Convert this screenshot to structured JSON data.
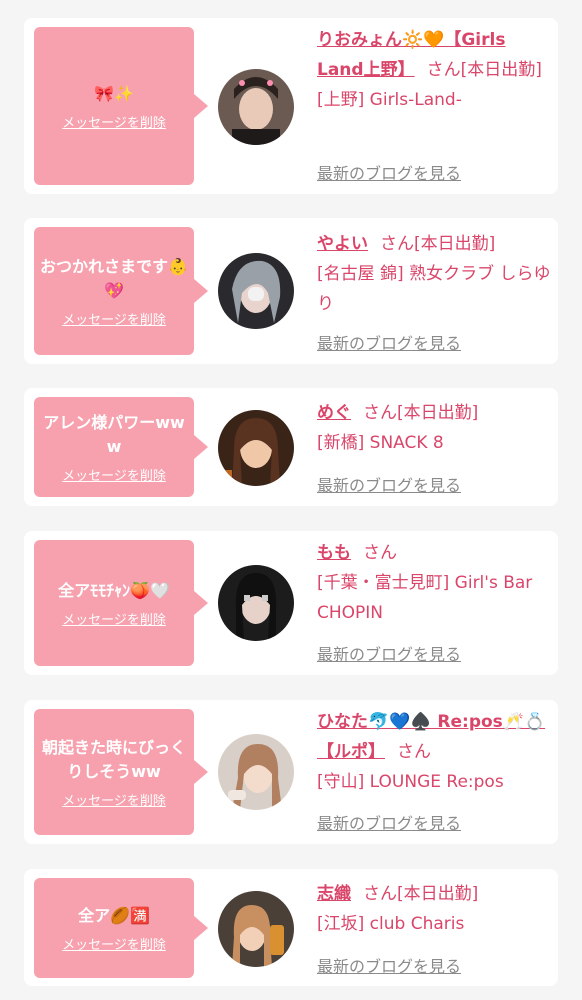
{
  "entries": [
    {
      "message": "🎀✨",
      "delete_label": "メッセージを削除",
      "name": "りおみょん🔆🧡【Girls Land上野】",
      "san": "さん",
      "status": "[本日出勤]",
      "shop": "[上野] Girls-Land-",
      "blog_label": "最新のブログを見る"
    },
    {
      "message": "おつかれさまです👶💖",
      "delete_label": "メッセージを削除",
      "name": "やよい",
      "san": "さん",
      "status": "[本日出勤]",
      "shop": "[名古屋 錦] 熟女クラブ しらゆり",
      "blog_label": "最新のブログを見る"
    },
    {
      "message": "アレン様パワーwww",
      "delete_label": "メッセージを削除",
      "name": "めぐ",
      "san": "さん",
      "status": "[本日出勤]",
      "shop": "[新橋] SNACK 8",
      "blog_label": "最新のブログを見る"
    },
    {
      "message": "全アﾓﾓﾁｬﾝ🍑🤍",
      "delete_label": "メッセージを削除",
      "name": "もも",
      "san": "さん",
      "status": "",
      "shop": "[千葉・富士見町] Girl's Bar CHOPIN",
      "blog_label": "最新のブログを見る"
    },
    {
      "message": "朝起きた時にびっくりしそうww",
      "delete_label": "メッセージを削除",
      "name": "ひなた🐬💙♠️ Re:pos🥂💍【ルポ】",
      "san": "さん",
      "status": "",
      "shop": "[守山] LOUNGE Re:pos",
      "blog_label": "最新のブログを見る"
    },
    {
      "message": "全ア🏉🈵",
      "delete_label": "メッセージを削除",
      "name": "志織",
      "san": "さん",
      "status": "[本日出勤]",
      "shop": "[江坂] club Charis",
      "blog_label": "最新のブログを見る"
    }
  ],
  "colors": {
    "accent": "#d9466a",
    "bubble": "#f7a1ae",
    "link_gray": "#8a8a8a",
    "background": "#f5f5f5"
  },
  "icons": [
    "avatar-photo"
  ]
}
